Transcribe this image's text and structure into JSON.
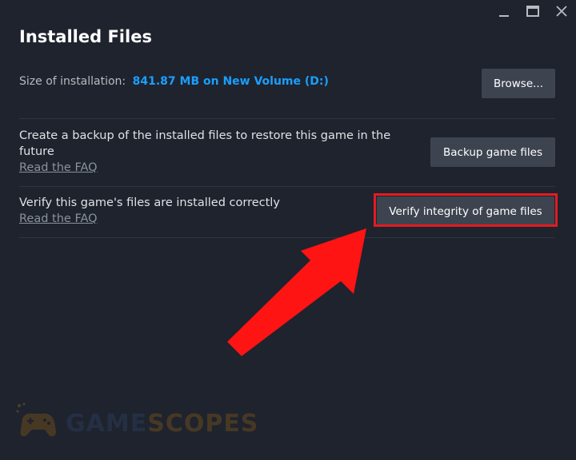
{
  "window": {
    "controls": [
      "minimize",
      "maximize",
      "close"
    ]
  },
  "header": {
    "title": "Installed Files"
  },
  "size": {
    "label": "Size of installation:",
    "value": "841.87 MB on New Volume (D:)",
    "browse_label": "Browse..."
  },
  "backup": {
    "description": "Create a backup of the installed files to restore this game in the future",
    "faq_label": "Read the FAQ",
    "button_label": "Backup game files"
  },
  "verify": {
    "description": "Verify this game's files are installed correctly",
    "faq_label": "Read the FAQ",
    "button_label": "Verify integrity of game files"
  },
  "annotation": {
    "highlight_color": "#e41b1f",
    "arrow_color": "#ff1414"
  },
  "watermark": {
    "part1": "GAME",
    "part2": "SCOPES",
    "icon": "gamepad-icon"
  },
  "colors": {
    "background": "#1e232e",
    "accent": "#1a9fff",
    "button": "#3d4450"
  }
}
